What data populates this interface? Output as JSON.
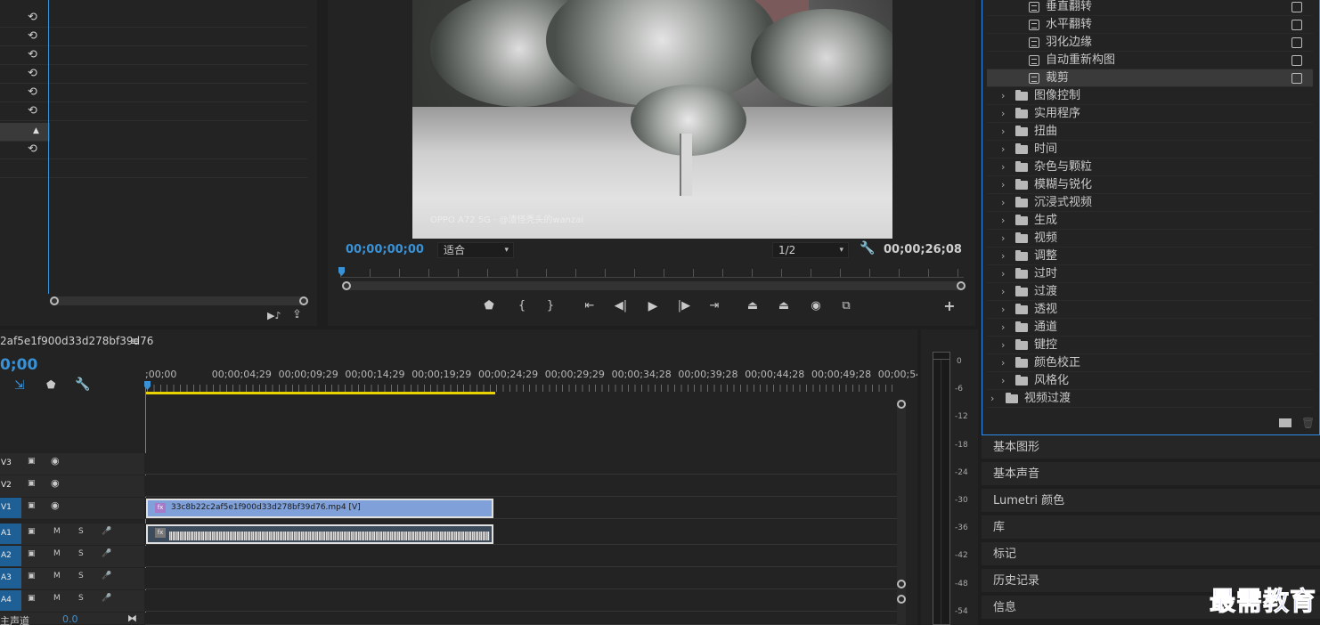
{
  "program_monitor": {
    "timecode_current": "00;00;00;00",
    "zoom_value": "适合",
    "resolution_value": "1/2",
    "timecode_duration": "00;00;26;08",
    "video_watermark": "OPPO A72 5G · @渣怪秃头的wanzai"
  },
  "timeline": {
    "sequence_name": "2af5e1f900d33d278bf39d76",
    "timecode": "0;00",
    "ruler_ticks": [
      ";00;00",
      "00;00;04;29",
      "00;00;09;29",
      "00;00;14;29",
      "00;00;19;29",
      "00;00;24;29",
      "00;00;29;29",
      "00;00;34;28",
      "00;00;39;28",
      "00;00;44;28",
      "00;00;49;28",
      "00;00;54;2"
    ],
    "tracks": {
      "v3": "V3",
      "v2": "V2",
      "v1": "V1",
      "a1": "A1",
      "a2": "A2",
      "a3": "A3",
      "a4": "A4",
      "mute": "M",
      "solo": "S"
    },
    "master_label": "主声道",
    "master_value": "0.0",
    "video_clip_name": "33c8b22c2af5e1f900d33d278bf39d76.mp4 [V]",
    "clip_fx_badge": "fx"
  },
  "audio_meter": {
    "db_labels": [
      "0",
      "-6",
      "-12",
      "-18",
      "-24",
      "-30",
      "-36",
      "-42",
      "-48",
      "-54"
    ]
  },
  "effects_panel": {
    "items": [
      {
        "label": "垂直翻转",
        "type": "effect"
      },
      {
        "label": "水平翻转",
        "type": "effect"
      },
      {
        "label": "羽化边缘",
        "type": "effect"
      },
      {
        "label": "自动重新构图",
        "type": "effect"
      },
      {
        "label": "裁剪",
        "type": "effect",
        "selected": true
      },
      {
        "label": "图像控制",
        "type": "folder"
      },
      {
        "label": "实用程序",
        "type": "folder"
      },
      {
        "label": "扭曲",
        "type": "folder"
      },
      {
        "label": "时间",
        "type": "folder"
      },
      {
        "label": "杂色与颗粒",
        "type": "folder"
      },
      {
        "label": "模糊与锐化",
        "type": "folder"
      },
      {
        "label": "沉浸式视频",
        "type": "folder"
      },
      {
        "label": "生成",
        "type": "folder"
      },
      {
        "label": "视频",
        "type": "folder"
      },
      {
        "label": "调整",
        "type": "folder"
      },
      {
        "label": "过时",
        "type": "folder"
      },
      {
        "label": "过渡",
        "type": "folder"
      },
      {
        "label": "透视",
        "type": "folder"
      },
      {
        "label": "通道",
        "type": "folder"
      },
      {
        "label": "键控",
        "type": "folder"
      },
      {
        "label": "颜色校正",
        "type": "folder"
      },
      {
        "label": "风格化",
        "type": "folder"
      },
      {
        "label": "视频过渡",
        "type": "root-folder"
      }
    ]
  },
  "side_tabs": [
    "基本图形",
    "基本声音",
    "Lumetri 颜色",
    "库",
    "标记",
    "历史记录",
    "信息"
  ],
  "overlay_logo": "最需教育",
  "colors": {
    "accent_blue": "#3a92d6",
    "selection_border": "#2d8ceb",
    "work_area_yellow": "#e8d200",
    "video_clip": "#7fa0d8",
    "track_target": "#1e5f95"
  }
}
